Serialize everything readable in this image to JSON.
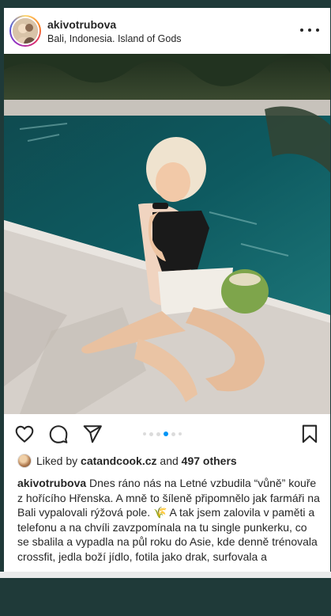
{
  "post": {
    "username": "akivotrubova",
    "location": "Bali, Indonesia. Island of Gods",
    "more_icon": "more-horizontal-icon"
  },
  "carousel": {
    "total": 6,
    "active": 3
  },
  "actions": {
    "like_icon": "heart-icon",
    "comment_icon": "comment-icon",
    "share_icon": "send-icon",
    "save_icon": "bookmark-icon"
  },
  "likes": {
    "prefix": "Liked by",
    "liker": "catandcook.cz",
    "conjunction": "and",
    "others": "497 others"
  },
  "caption": {
    "author": "akivotrubova",
    "text": "Dnes ráno nás na Letné vzbudila “vůně” kouře z hořícího Hřenska. A mně to šíleně připomnělo jak farmáři na Bali vypalovali rýžová pole. 🌾 A tak jsem zalovila v paměti a telefonu a na chvíli zavzpomínala na tu single punkerku, co se sbalila a vypadla na půl roku do Asie, kde denně trénovala crossfit, jedla boží jídlo, fotila jako drak, surfovala a"
  },
  "colors": {
    "background": "#1f3a39",
    "card": "#ffffff",
    "accent": "#0095f6",
    "text": "#262626"
  }
}
